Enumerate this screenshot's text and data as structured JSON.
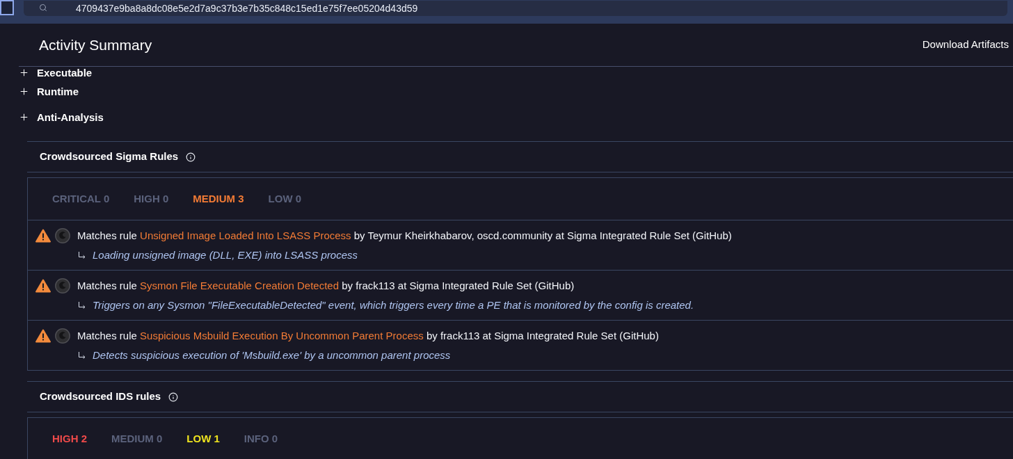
{
  "top_bar": {
    "search": {
      "value": "4709437e9ba8a8dc08e5e2d7a9c37b3e7b35c848c15ed1e75f7ee05204d43d59"
    }
  },
  "header": {
    "title": "Activity Summary",
    "action": "Download Artifacts"
  },
  "behavior_groups": [
    {
      "label": "Executable",
      "expanded": false
    },
    {
      "label": "Runtime",
      "expanded": false
    },
    {
      "label": "Anti-Analysis",
      "expanded": false
    }
  ],
  "sigma_rules": {
    "title": "Crowdsourced Sigma Rules",
    "tabs": [
      {
        "label": "CRITICAL 0",
        "color": "#5b627c"
      },
      {
        "label": "HIGH 0",
        "color": "#5b627c"
      },
      {
        "label": "MEDIUM 3",
        "color": "#f27b35"
      },
      {
        "label": "LOW 0",
        "color": "#5b627c"
      }
    ],
    "matches": [
      {
        "text_before": "Matches rule",
        "rule": "Unsigned Image Loaded Into LSASS Process",
        "text_after": "by Teymur Kheirkhabarov, oscd.community at Sigma Integrated Rule Set (GitHub)",
        "description": "Loading unsigned image (DLL, EXE) into LSASS process"
      },
      {
        "text_before": "Matches rule",
        "rule": "Sysmon File Executable Creation Detected",
        "text_after": "by frack113 at Sigma Integrated Rule Set (GitHub)",
        "description": "Triggers on any Sysmon \"FileExecutableDetected\" event, which triggers every time a PE that is monitored by the config is created."
      },
      {
        "text_before": "Matches rule",
        "rule": "Suspicious Msbuild Execution By Uncommon Parent Process",
        "text_after": "by frack113 at Sigma Integrated Rule Set (GitHub)",
        "description": "Detects suspicious execution of 'Msbuild.exe' by a uncommon parent process"
      }
    ]
  },
  "ids_rules": {
    "title": "Crowdsourced IDS rules",
    "tabs": [
      {
        "label": "HIGH 2",
        "color": "#ef4a4a"
      },
      {
        "label": "MEDIUM 0",
        "color": "#5b627c"
      },
      {
        "label": "LOW 1",
        "color": "#eee31f"
      },
      {
        "label": "INFO 0",
        "color": "#5b627c"
      }
    ]
  }
}
